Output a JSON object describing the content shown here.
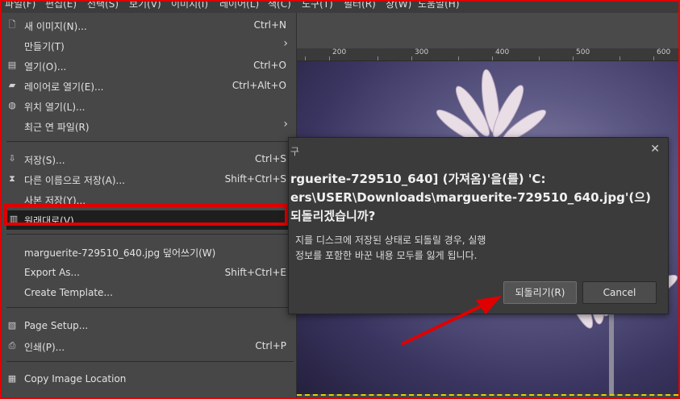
{
  "menubar": {
    "items": [
      "파일(F)",
      "편집(E)",
      "선택(S)",
      "보기(V)",
      "이미지(I)",
      "레이어(L)",
      "색(C)",
      "도구(T)",
      "필터(R)",
      "창(W)",
      "도움말(H)"
    ]
  },
  "ruler": {
    "labels": [
      "200",
      "300",
      "400",
      "500",
      "600"
    ]
  },
  "file_menu": {
    "new_image": {
      "label": "새 이미지(N)...",
      "shortcut": "Ctrl+N",
      "icon": "new-file-icon"
    },
    "create": {
      "label": "만들기(T)",
      "icon": "submenu-arrow-icon"
    },
    "open": {
      "label": "열기(O)...",
      "shortcut": "Ctrl+O",
      "icon": "open-icon"
    },
    "open_as_layers": {
      "label": "레이어로 열기(E)...",
      "shortcut": "Ctrl+Alt+O",
      "icon": "layers-icon"
    },
    "open_location": {
      "label": "위치 열기(L)...",
      "icon": "globe-icon"
    },
    "recent": {
      "label": "최근 연 파일(R)",
      "icon": "submenu-arrow-icon"
    },
    "save": {
      "label": "저장(S)...",
      "shortcut": "Ctrl+S",
      "icon": "save-icon"
    },
    "save_as": {
      "label": "다른 이름으로 저장(A)...",
      "shortcut": "Shift+Ctrl+S",
      "icon": "save-as-icon"
    },
    "save_copy": {
      "label": "사본 저장(Y)..."
    },
    "revert": {
      "label": "원래대로(V)",
      "icon": "revert-icon"
    },
    "overwrite": {
      "label": "marguerite-729510_640.jpg 덮어쓰기(W)"
    },
    "export_as": {
      "label": "Export As...",
      "shortcut": "Shift+Ctrl+E"
    },
    "create_template": {
      "label": "Create Template..."
    },
    "page_setup": {
      "label": "Page Setup...",
      "icon": "page-setup-icon"
    },
    "print": {
      "label": "인쇄(P)...",
      "shortcut": "Ctrl+P",
      "icon": "print-icon"
    },
    "copy_location": {
      "label": "Copy Image Location",
      "icon": "copy-location-icon"
    }
  },
  "dialog": {
    "title": "구",
    "message_lines": [
      "rguerite-729510_640] (가져옴)'을(를) 'C:",
      "ers\\USER\\Downloads\\marguerite-729510_640.jpg'(으)",
      "되돌리겠습니까?"
    ],
    "description_lines": [
      "지를 디스크에 저장된 상태로 되돌릴 경우, 실행",
      "정보를 포함한 바꾼 내용 모두를 잃게 됩니다."
    ],
    "revert_button": "되돌리기(R)",
    "cancel_button": "Cancel",
    "close_symbol": "✕"
  },
  "colors": {
    "highlight": "#e00000",
    "menu_bg": "#474747",
    "dialog_bg": "#3b3b3b",
    "selection": "#e8d000"
  }
}
